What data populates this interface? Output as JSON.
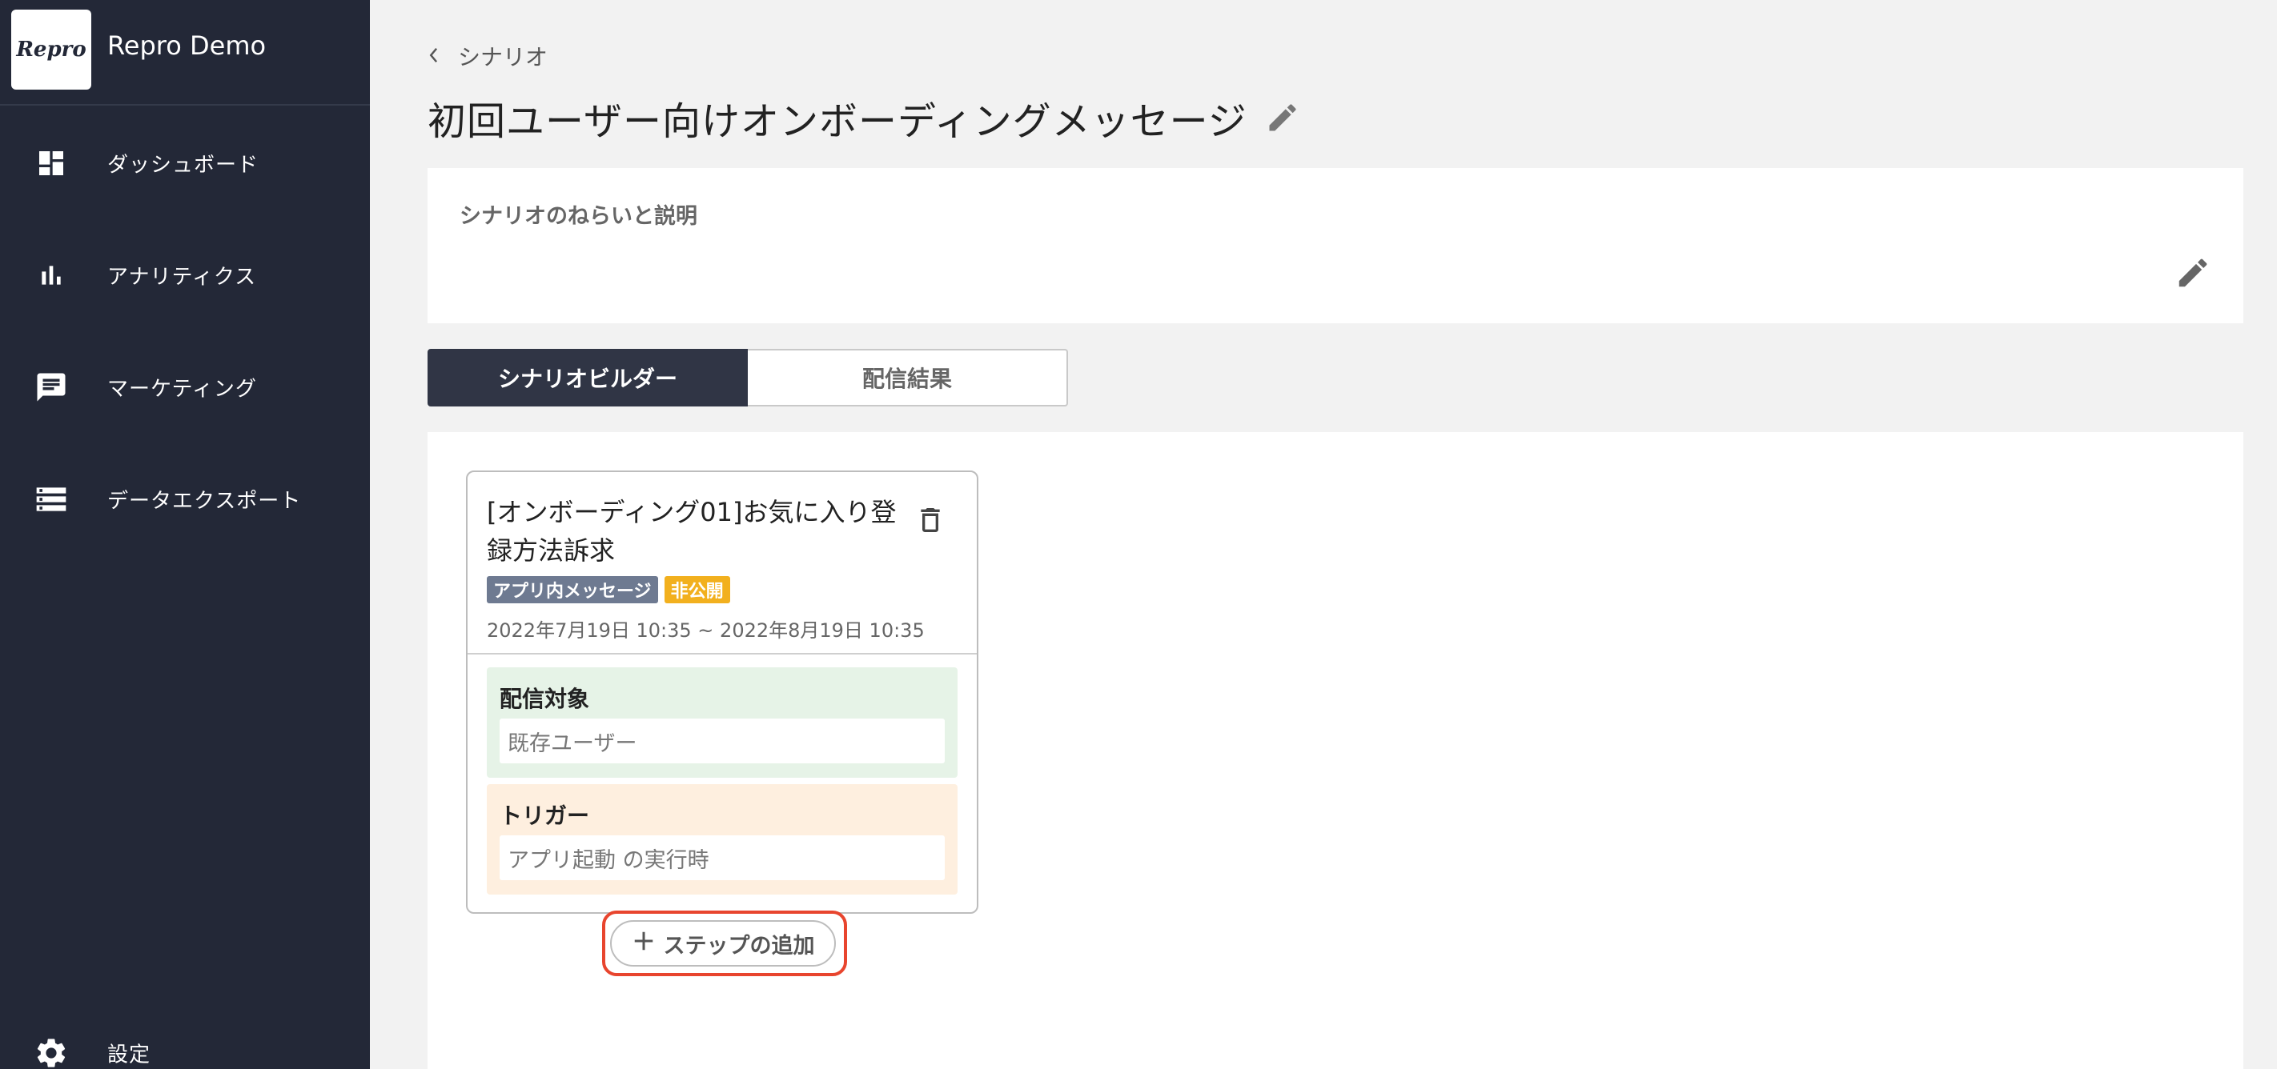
{
  "brand": {
    "logo_text": "Repro",
    "name": "Repro Demo"
  },
  "sidebar": {
    "items": [
      {
        "label": "ダッシュボード",
        "icon": "dashboard-icon"
      },
      {
        "label": "アナリティクス",
        "icon": "bar-chart-icon"
      },
      {
        "label": "マーケティング",
        "icon": "message-icon"
      },
      {
        "label": "データエクスポート",
        "icon": "storage-icon"
      }
    ],
    "settings": {
      "label": "設定",
      "icon": "gear-icon"
    }
  },
  "breadcrumb": {
    "back_label": "シナリオ",
    "icon": "chevron-left-icon"
  },
  "page": {
    "title": "初回ユーザー向けオンボーディングメッセージ"
  },
  "description": {
    "label": "シナリオのねらいと説明"
  },
  "tabs": [
    {
      "label": "シナリオビルダー",
      "active": true
    },
    {
      "label": "配信結果",
      "active": false
    }
  ],
  "card": {
    "title": "[オンボーディング01]お気に入り登録方法訴求",
    "badges": {
      "type": "アプリ内メッセージ",
      "status": "非公開"
    },
    "period": "2022年7月19日 10:35 ~ 2022年8月19日 10:35",
    "target": {
      "label": "配信対象",
      "value": "既存ユーザー"
    },
    "trigger": {
      "label": "トリガー",
      "value": "アプリ起動 の実行時"
    }
  },
  "add_step": {
    "label": "ステップの追加"
  },
  "colors": {
    "sidebar_bg": "#232837",
    "active_tab_bg": "#303545",
    "badge_type": "#6e7a91",
    "badge_status": "#f2b01e",
    "target_bg": "#e6f3e7",
    "trigger_bg": "#feefdf",
    "highlight": "#e8452e"
  }
}
